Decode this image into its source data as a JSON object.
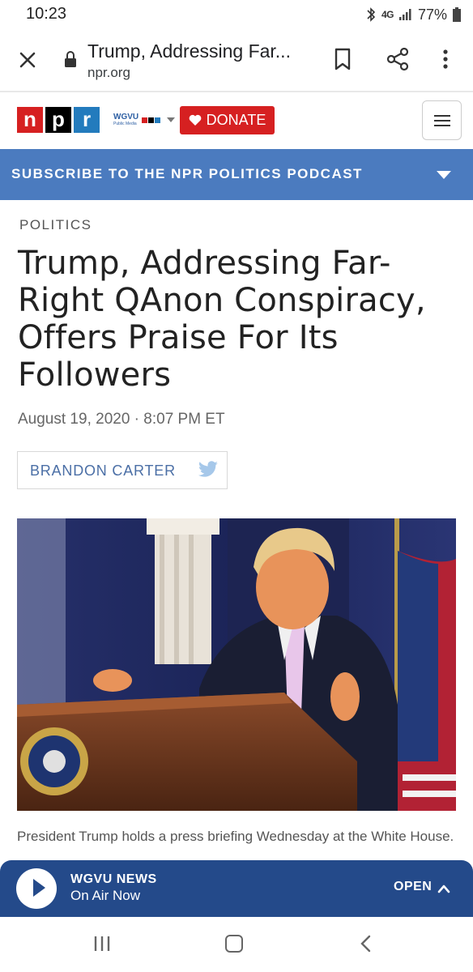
{
  "status_bar": {
    "time": "10:23",
    "network": "4G",
    "battery": "77%"
  },
  "browser": {
    "page_title": "Trump, Addressing Far...",
    "domain": "npr.org"
  },
  "npr_header": {
    "logo_letters": [
      "n",
      "p",
      "r"
    ],
    "station_name": "WGVU",
    "station_sub": "Public Media",
    "donate_label": "DONATE"
  },
  "podcast_banner": {
    "label": "SUBSCRIBE TO THE NPR POLITICS PODCAST"
  },
  "article": {
    "section": "POLITICS",
    "headline": "Trump, Addressing Far-Right QAnon Conspiracy, Offers Praise For Its Followers",
    "date": "August 19, 2020 · 8:07 PM ET",
    "author": "BRANDON CARTER",
    "caption": "President Trump holds a press briefing Wednesday at the White House."
  },
  "player": {
    "station": "WGVU NEWS",
    "status": "On Air Now",
    "open_label": "OPEN"
  },
  "colors": {
    "npr_red": "#d62021",
    "npr_blue": "#237bbd",
    "banner_blue": "#4b7bbf",
    "player_blue": "#244a8a"
  }
}
